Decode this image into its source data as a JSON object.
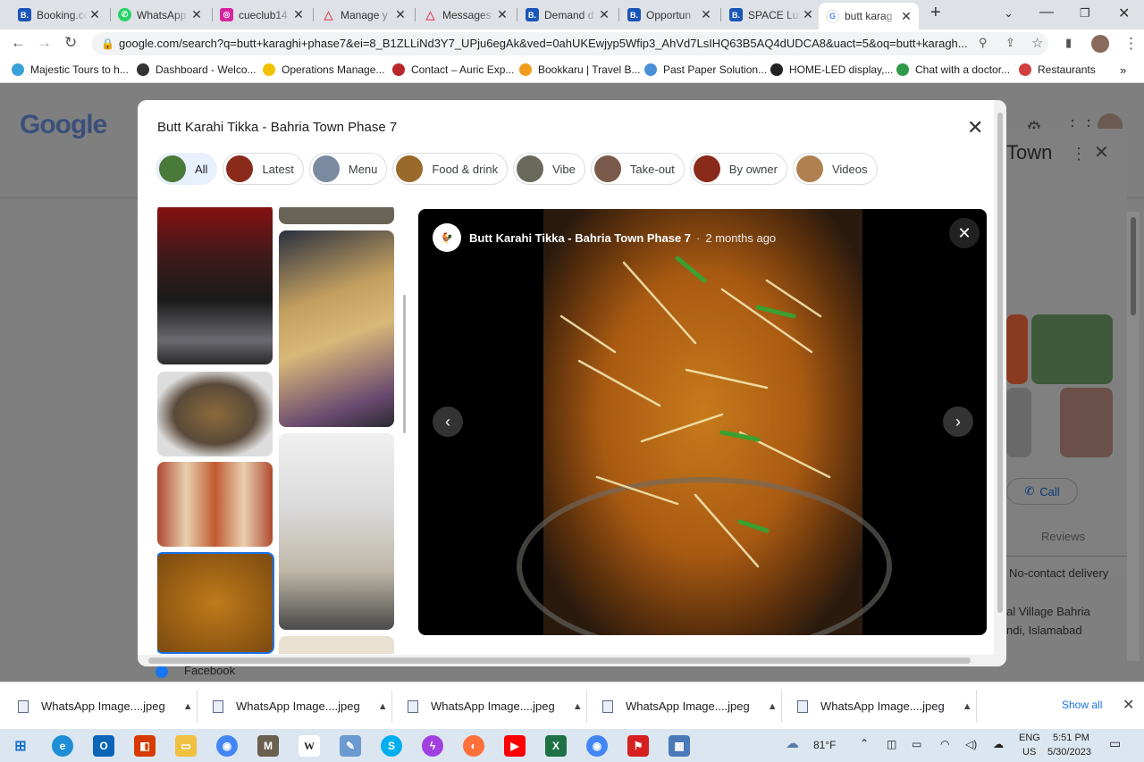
{
  "browser": {
    "tabs": [
      {
        "label": "Booking.co",
        "icon": "booking-icon",
        "color": "#1a56b8"
      },
      {
        "label": "WhatsApp",
        "icon": "whatsapp-icon",
        "color": "#25d366"
      },
      {
        "label": "cueclub14",
        "icon": "instagram-icon",
        "color": "#d6249f"
      },
      {
        "label": "Manage y",
        "icon": "airbnb-icon",
        "color": "#e0526e"
      },
      {
        "label": "Messages",
        "icon": "airbnb-icon",
        "color": "#e0526e"
      },
      {
        "label": "Demand d",
        "icon": "booking-icon",
        "color": "#1a56b8"
      },
      {
        "label": "Opportun",
        "icon": "booking-icon",
        "color": "#1a56b8"
      },
      {
        "label": "SPACE Lux",
        "icon": "booking-icon",
        "color": "#1a56b8"
      },
      {
        "label": "butt karag",
        "icon": "google-icon",
        "color": "#4285f4",
        "active": true
      }
    ],
    "url": "google.com/search?q=butt+karaghi+phase7&ei=8_B1ZLLiNd3Y7_UPju6egAk&ved=0ahUKEwjyp5Wfip3_AhVd7LsIHQ63B5AQ4dUDCA8&uact=5&oq=butt+karagh...",
    "bookmarks": [
      {
        "label": "Majestic Tours to h...",
        "color": "#3aa0d8"
      },
      {
        "label": "Dashboard - Welco...",
        "color": "#333333"
      },
      {
        "label": "Operations Manage...",
        "color": "#f2c200"
      },
      {
        "label": "Contact – Auric Exp...",
        "color": "#b8262b"
      },
      {
        "label": "Bookkaru | Travel B...",
        "color": "#f29b1d"
      },
      {
        "label": "Past Paper Solution...",
        "color": "#4a90d9"
      },
      {
        "label": "HOME-LED display,...",
        "color": "#222222"
      },
      {
        "label": "Chat with a doctor...",
        "color": "#2e9a4a"
      },
      {
        "label": "Restaurants",
        "color": "#d04040"
      }
    ]
  },
  "google": {
    "logo": "Google"
  },
  "right_panel": {
    "title": "Town",
    "call": "Call",
    "reviews": "Reviews",
    "no_contact": "No-contact delivery",
    "address_line1": "al Village Bahria",
    "address_line2": "ndi, Islamabad"
  },
  "modal": {
    "title": "Butt Karahi Tikka - Bahria Town Phase 7",
    "chips": [
      {
        "label": "All",
        "selected": true,
        "color": "#4a7a3a"
      },
      {
        "label": "Latest",
        "color": "#8a2a1a"
      },
      {
        "label": "Menu",
        "color": "#7a8aa0"
      },
      {
        "label": "Food & drink",
        "color": "#9a6a2a"
      },
      {
        "label": "Vibe",
        "color": "#6a6a5a"
      },
      {
        "label": "Take-out",
        "color": "#7a5a4a"
      },
      {
        "label": "By owner",
        "color": "#8a2a1a"
      },
      {
        "label": "Videos",
        "color": "#b08050"
      }
    ],
    "viewer": {
      "place": "Butt Karahi Tikka - Bahria Town Phase 7",
      "separator": "·",
      "time": "2 months ago"
    }
  },
  "facebook": "Facebook",
  "downloads": {
    "items": [
      "WhatsApp Image....jpeg",
      "WhatsApp Image....jpeg",
      "WhatsApp Image....jpeg",
      "WhatsApp Image....jpeg",
      "WhatsApp Image....jpeg"
    ],
    "show_all": "Show all"
  },
  "taskbar": {
    "weather": "81°F",
    "lang1": "ENG",
    "lang2": "US",
    "time": "5:51 PM",
    "date": "5/30/2023"
  }
}
